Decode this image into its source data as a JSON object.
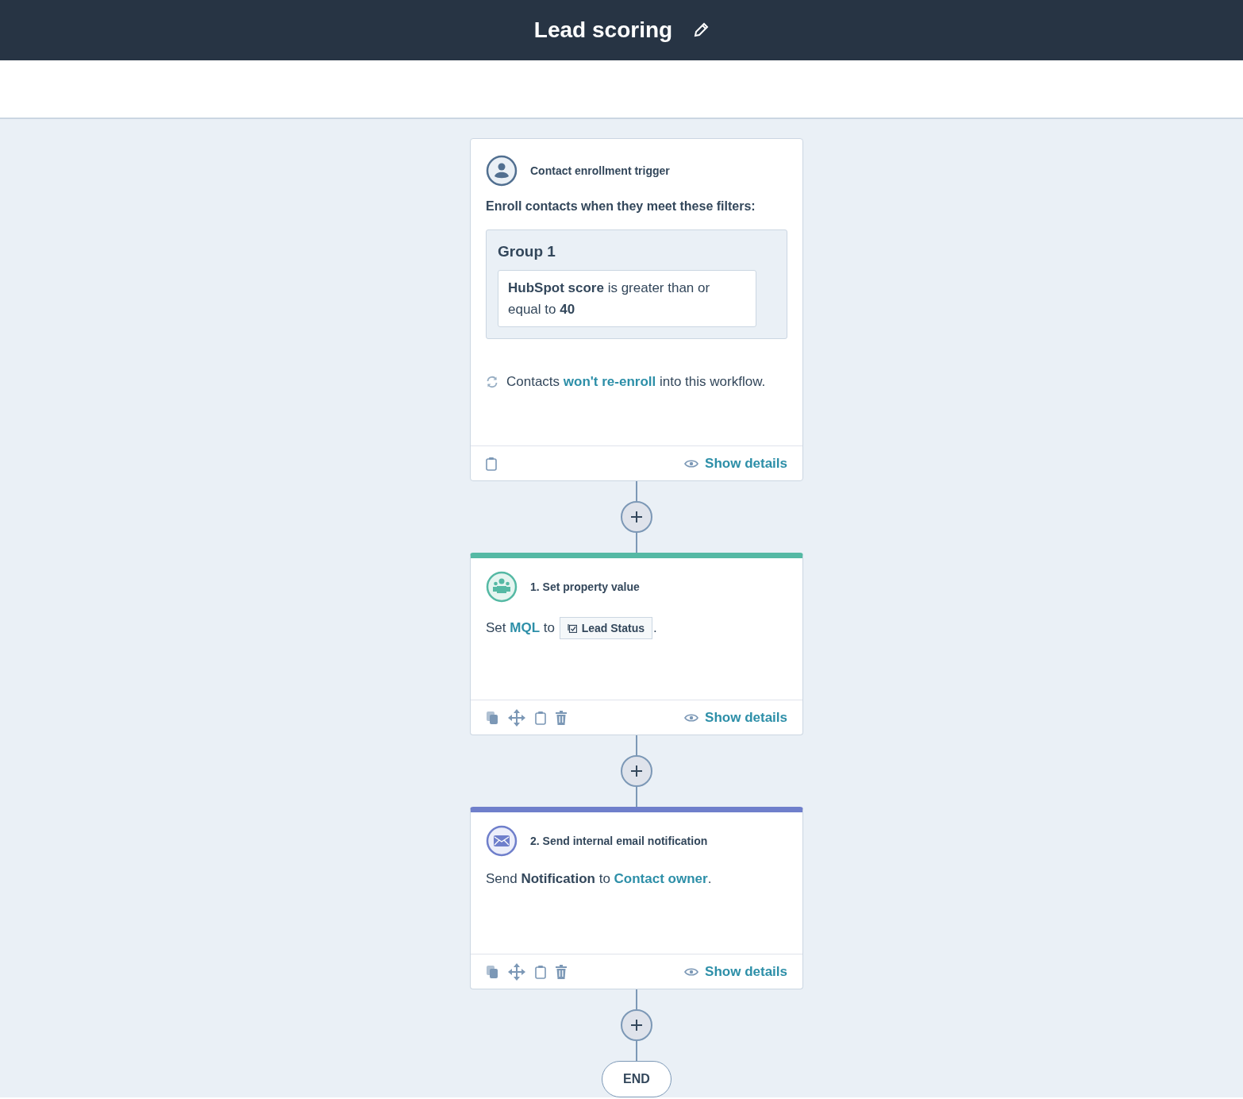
{
  "header": {
    "title": "Lead scoring"
  },
  "trigger": {
    "title": "Contact enrollment trigger",
    "intro": "Enroll contacts when they meet these filters:",
    "group": {
      "title": "Group 1",
      "filter": "**HubSpot score** is greater than or equal to **40**"
    },
    "reenroll": [
      {
        "kind": "text",
        "text": "Contacts "
      },
      {
        "kind": "link",
        "text": "won't re-enroll"
      },
      {
        "kind": "text",
        "text": " into this workflow."
      }
    ],
    "footer_link": "Show details"
  },
  "actions": [
    {
      "kind": "property",
      "title": "1. Set property value",
      "color": "#55b9a4",
      "sentence": [
        {
          "kind": "text",
          "text": "Set "
        },
        {
          "kind": "link",
          "text": "MQL"
        },
        {
          "kind": "text",
          "text": " to "
        },
        {
          "kind": "token",
          "text": "Lead Status"
        },
        {
          "kind": "text",
          "text": "."
        }
      ],
      "footer_link": "Show details"
    },
    {
      "kind": "email",
      "title": "2. Send internal email notification",
      "color": "#6f7fcb",
      "sentence": [
        {
          "kind": "text",
          "text": "Send "
        },
        {
          "kind": "bold",
          "text": "Notification"
        },
        {
          "kind": "text",
          "text": " to "
        },
        {
          "kind": "link",
          "text": "Contact owner"
        },
        {
          "kind": "text",
          "text": "."
        }
      ],
      "footer_link": "Show details"
    }
  ],
  "end": "END"
}
